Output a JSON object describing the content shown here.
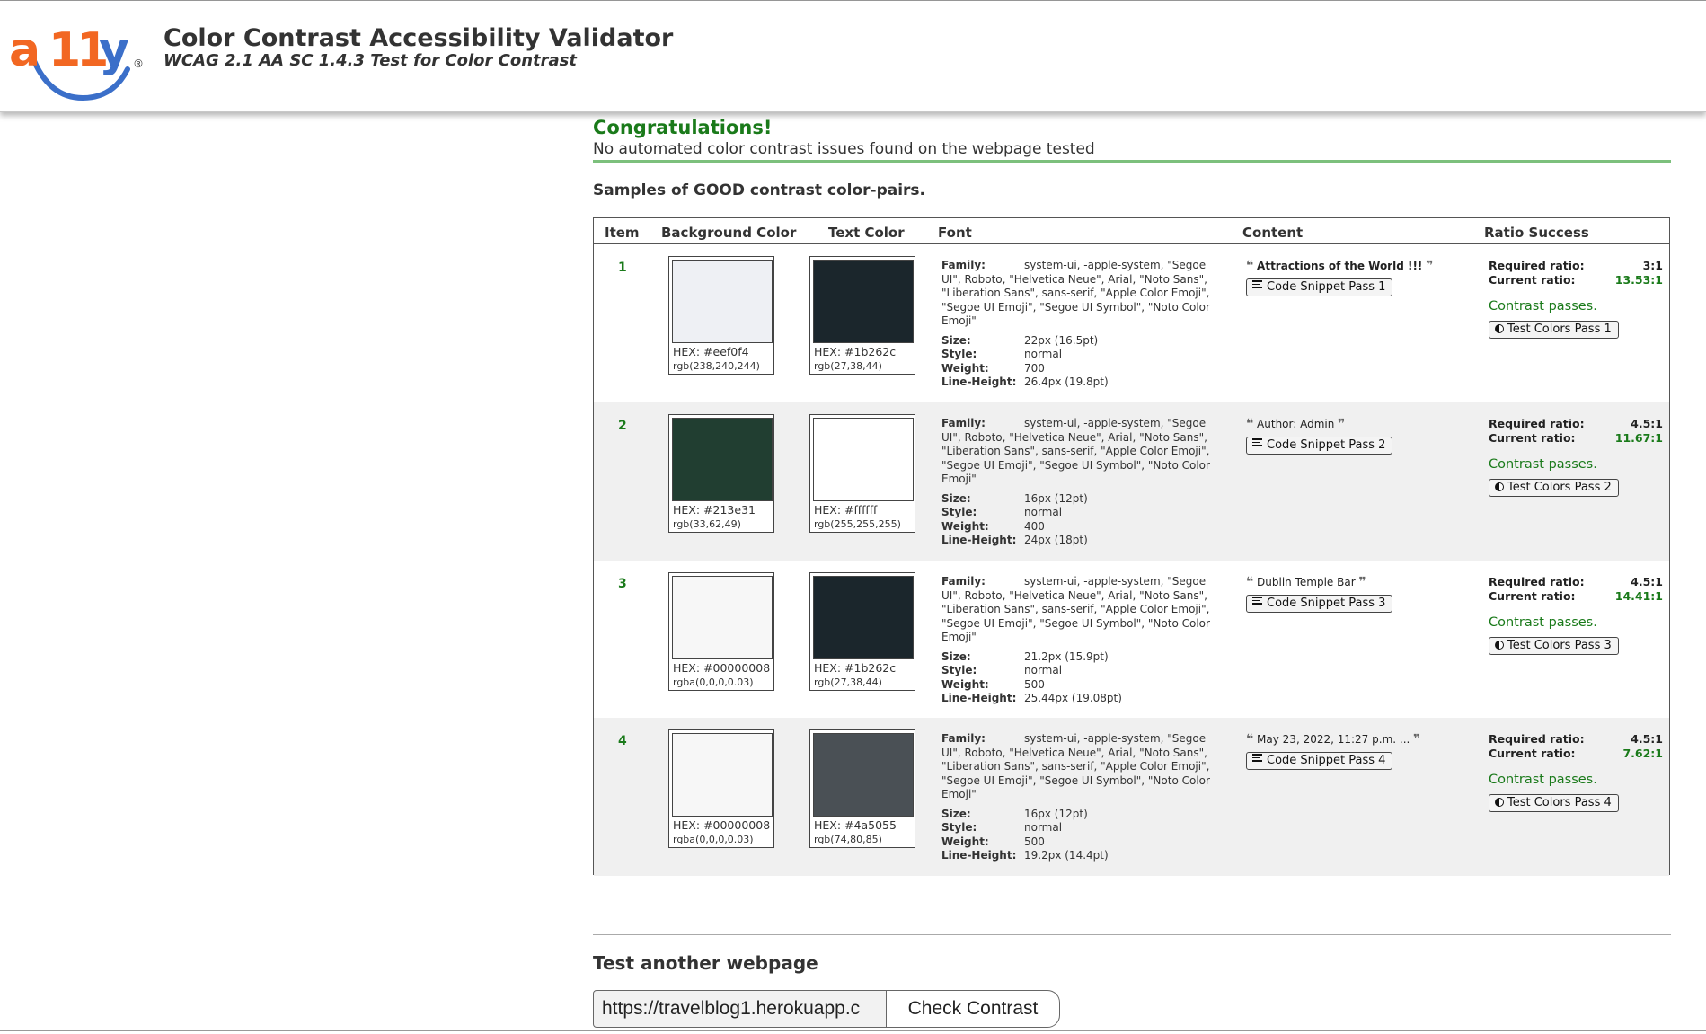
{
  "header": {
    "logo_text": "a11y",
    "registered_mark": "®",
    "title": "Color Contrast Accessibility Validator",
    "subtitle": "WCAG 2.1 AA SC 1.4.3 Test for Color Contrast"
  },
  "result": {
    "heading": "Congratulations!",
    "message": "No automated color contrast issues found on the webpage tested",
    "samples_heading": "Samples of GOOD contrast color-pairs."
  },
  "table": {
    "columns": [
      "Item",
      "Background Color",
      "Text Color",
      "Font",
      "Content",
      "Ratio Success"
    ],
    "labels": {
      "family": "Family:",
      "size": "Size:",
      "style": "Style:",
      "weight": "Weight:",
      "line_height": "Line-Height:",
      "required": "Required ratio:",
      "current": "Current ratio:",
      "passes": "Contrast passes."
    },
    "rows": [
      {
        "item": "1",
        "bg_hex": "HEX: #eef0f4",
        "bg_rgb": "rgb(238,240,244)",
        "bg_color": "#eef0f4",
        "fg_hex": "HEX: #1b262c",
        "fg_rgb": "rgb(27,38,44)",
        "fg_color": "#1b262c",
        "family": "system-ui, -apple-system, \"Segoe UI\", Roboto, \"Helvetica Neue\", Arial, \"Noto Sans\", \"Liberation Sans\", sans-serif, \"Apple Color Emoji\", \"Segoe UI Emoji\", \"Segoe UI Symbol\", \"Noto Color Emoji\"",
        "size": "22px (16.5pt)",
        "style": "normal",
        "weight": "700",
        "line_height": "26.4px (19.8pt)",
        "content_text": "Attractions of the World !!!",
        "content_bold": true,
        "snippet_label": "Code Snippet Pass 1",
        "required_ratio": "3:1",
        "current_ratio": "13.53:1",
        "test_label": "Test Colors Pass 1"
      },
      {
        "item": "2",
        "bg_hex": "HEX: #213e31",
        "bg_rgb": "rgb(33,62,49)",
        "bg_color": "#213e31",
        "fg_hex": "HEX: #ffffff",
        "fg_rgb": "rgb(255,255,255)",
        "fg_color": "#ffffff",
        "family": "system-ui, -apple-system, \"Segoe UI\", Roboto, \"Helvetica Neue\", Arial, \"Noto Sans\", \"Liberation Sans\", sans-serif, \"Apple Color Emoji\", \"Segoe UI Emoji\", \"Segoe UI Symbol\", \"Noto Color Emoji\"",
        "size": "16px (12pt)",
        "style": "normal",
        "weight": "400",
        "line_height": "24px (18pt)",
        "content_text": "Author: Admin",
        "content_bold": false,
        "snippet_label": "Code Snippet Pass 2",
        "required_ratio": "4.5:1",
        "current_ratio": "11.67:1",
        "test_label": "Test Colors Pass 2"
      },
      {
        "item": "3",
        "bg_hex": "HEX: #00000008",
        "bg_rgb": "rgba(0,0,0,0.03)",
        "bg_color": "#f7f7f7",
        "fg_hex": "HEX: #1b262c",
        "fg_rgb": "rgb(27,38,44)",
        "fg_color": "#1b262c",
        "family": "system-ui, -apple-system, \"Segoe UI\", Roboto, \"Helvetica Neue\", Arial, \"Noto Sans\", \"Liberation Sans\", sans-serif, \"Apple Color Emoji\", \"Segoe UI Emoji\", \"Segoe UI Symbol\", \"Noto Color Emoji\"",
        "size": "21.2px (15.9pt)",
        "style": "normal",
        "weight": "500",
        "line_height": "25.44px (19.08pt)",
        "content_text": "Dublin Temple Bar",
        "content_bold": false,
        "snippet_label": "Code Snippet Pass 3",
        "required_ratio": "4.5:1",
        "current_ratio": "14.41:1",
        "test_label": "Test Colors Pass 3"
      },
      {
        "item": "4",
        "bg_hex": "HEX: #00000008",
        "bg_rgb": "rgba(0,0,0,0.03)",
        "bg_color": "#f7f7f7",
        "fg_hex": "HEX: #4a5055",
        "fg_rgb": "rgb(74,80,85)",
        "fg_color": "#4a5055",
        "family": "system-ui, -apple-system, \"Segoe UI\", Roboto, \"Helvetica Neue\", Arial, \"Noto Sans\", \"Liberation Sans\", sans-serif, \"Apple Color Emoji\", \"Segoe UI Emoji\", \"Segoe UI Symbol\", \"Noto Color Emoji\"",
        "size": "16px (12pt)",
        "style": "normal",
        "weight": "500",
        "line_height": "19.2px (14.4pt)",
        "content_text": "May 23, 2022, 11:27 p.m. ...",
        "content_bold": false,
        "snippet_label": "Code Snippet Pass 4",
        "required_ratio": "4.5:1",
        "current_ratio": "7.62:1",
        "test_label": "Test Colors Pass 4"
      }
    ]
  },
  "test_another": {
    "heading": "Test another webpage",
    "url_value": "https://travelblog1.herokuapp.c",
    "button_label": "Check Contrast"
  },
  "colors": {
    "logo_orange": "#f26722",
    "logo_blue": "#3b6fc9",
    "success_green": "#1a7a1a",
    "rule_green": "#7cc07c"
  }
}
